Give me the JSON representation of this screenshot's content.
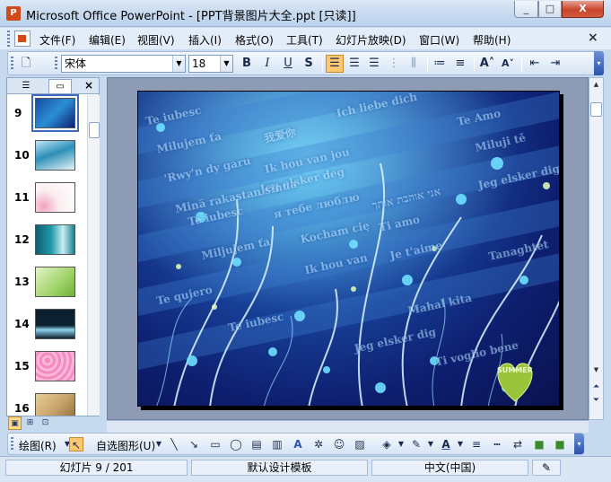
{
  "window": {
    "title": "Microsoft Office PowerPoint - [PPT背景图片大全.ppt [只读]]",
    "app_icon_letter": "P",
    "minimize": "_",
    "maximize": "□",
    "close": "X"
  },
  "menu": {
    "items": [
      "文件(F)",
      "编辑(E)",
      "视图(V)",
      "插入(I)",
      "格式(O)",
      "工具(T)",
      "幻灯片放映(D)",
      "窗口(W)",
      "帮助(H)"
    ],
    "close_glyph": "×"
  },
  "format_toolbar": {
    "font_name": "宋体",
    "font_size": "18",
    "bold": "B",
    "italic": "I",
    "underline": "U",
    "shadow": "S",
    "align_left_active": true
  },
  "slides_pane": {
    "tabs": [
      "outline",
      "slides"
    ],
    "close_glyph": "×",
    "thumbnails": [
      {
        "number": "9",
        "selected": true,
        "color": "#1a4ba4"
      },
      {
        "number": "10",
        "selected": false,
        "color": "#2d8fb8"
      },
      {
        "number": "11",
        "selected": false,
        "color": "#fbeef0"
      },
      {
        "number": "12",
        "selected": false,
        "color": "#1f9aa8"
      },
      {
        "number": "13",
        "selected": false,
        "color": "#9fd36a"
      },
      {
        "number": "14",
        "selected": false,
        "color": "#0d2030"
      },
      {
        "number": "15",
        "selected": false,
        "color": "#f58ac0"
      },
      {
        "number": "16",
        "selected": false,
        "color": "#c9a46a"
      }
    ]
  },
  "slide": {
    "background_words": [
      "Te iubesc",
      "Milujem ťa",
      "'Rwy'n dy garu",
      "Jeg elsker deg",
      "Te iubesc",
      "Miljujem ťa",
      "Te iubesc",
      "我爱你",
      "Ik hou van jou",
      "я тебе люблю",
      "Kocham cię",
      "Ik hou van",
      "Te Amo",
      "Miluji tě",
      "Jeg elsker dig",
      "Ti amo",
      "Je t'aime",
      "Minä rakastan sinua",
      "אני אוהבת אותך",
      "Mahal kita",
      "Ich liebe dich",
      "Ti voglio bene",
      "Jeg elsker dig",
      "Tanaghtet",
      "Te quiero"
    ],
    "badge_text": "SUMMER"
  },
  "drawing_toolbar": {
    "draw_label": "绘图(R)",
    "autoshapes_label": "自选图形(U)"
  },
  "status": {
    "slide_info": "幻灯片 9 / 201",
    "design": "默认设计模板",
    "language": "中文(中国)"
  }
}
